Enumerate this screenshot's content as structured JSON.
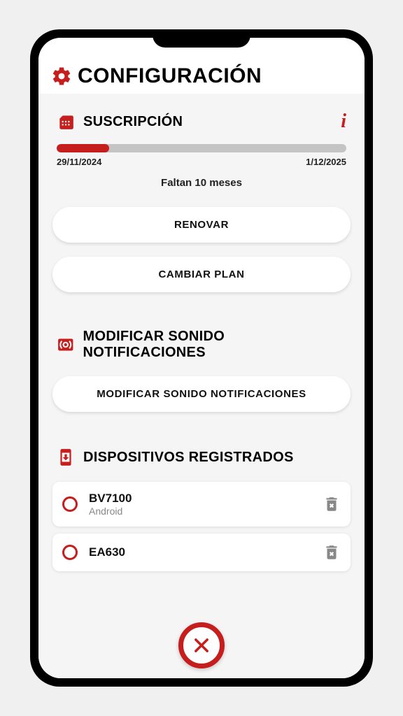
{
  "colors": {
    "accent": "#c61d1d"
  },
  "header": {
    "title": "CONFIGURACIÓN"
  },
  "subscription": {
    "title": "SUSCRIPCIÓN",
    "start_date": "29/11/2024",
    "end_date": "1/12/2025",
    "progress_percent": 18,
    "remaining_text": "Faltan 10 meses",
    "renew_label": "RENOVAR",
    "change_plan_label": "CAMBIAR PLAN"
  },
  "notification_sound": {
    "title": "MODIFICAR SONIDO NOTIFICACIONES",
    "button_label": "MODIFICAR SONIDO NOTIFICACIONES"
  },
  "devices": {
    "title": "DISPOSITIVOS REGISTRADOS",
    "items": [
      {
        "name": "BV7100",
        "platform": "Android"
      },
      {
        "name": "EA630",
        "platform": ""
      }
    ]
  }
}
